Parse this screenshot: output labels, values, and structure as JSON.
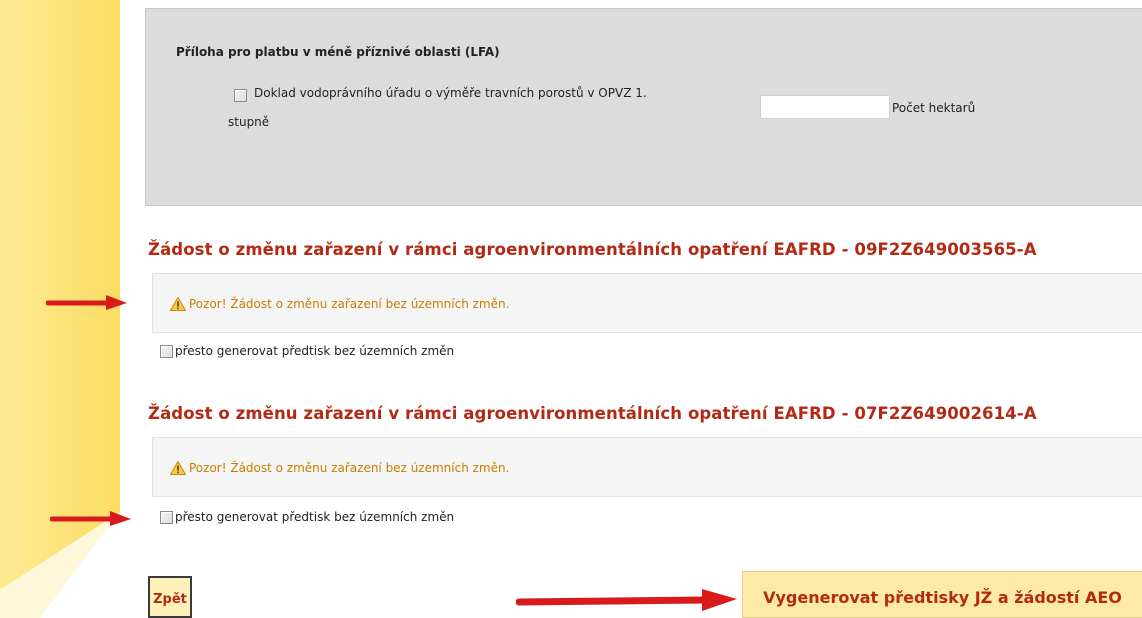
{
  "lfa": {
    "title": "Příloha pro platbu v méně příznivé oblasti (LFA)",
    "doc_label": "Doklad vodoprávního úřadu o výměře travních porostů v OPVZ 1.",
    "doc_label_cont": "stupně",
    "hectare_value": "",
    "hectare_label": "Počet hektarů"
  },
  "requests": [
    {
      "heading": "Žádost o změnu zařazení v rámci agroenvironmentálních opatření EAFRD - 09F2Z649003565-A",
      "warning": "Pozor! Žádost o změnu zařazení bez územních změn.",
      "option_label": "přesto generovat předtisk bez územních změn"
    },
    {
      "heading": "Žádost o změnu zařazení v rámci agroenvironmentálních opatření EAFRD - 07F2Z649002614-A",
      "warning": "Pozor! Žádost o změnu zařazení bez územních změn.",
      "option_label": "přesto generovat předtisk bez územních změn"
    }
  ],
  "actions": {
    "back_label": "Zpět",
    "generate_label": "Vygenerovat předtisky JŽ a žádostí AEO"
  },
  "icons": {
    "warning": "warning-triangle-icon",
    "arrow": "red-arrow-icon"
  },
  "colors": {
    "heading": "#b22a14",
    "warning_text": "#c97d00",
    "sidebar": "#fde57a",
    "panel": "#dcdcdc",
    "button_bg": "#fde9a8"
  }
}
